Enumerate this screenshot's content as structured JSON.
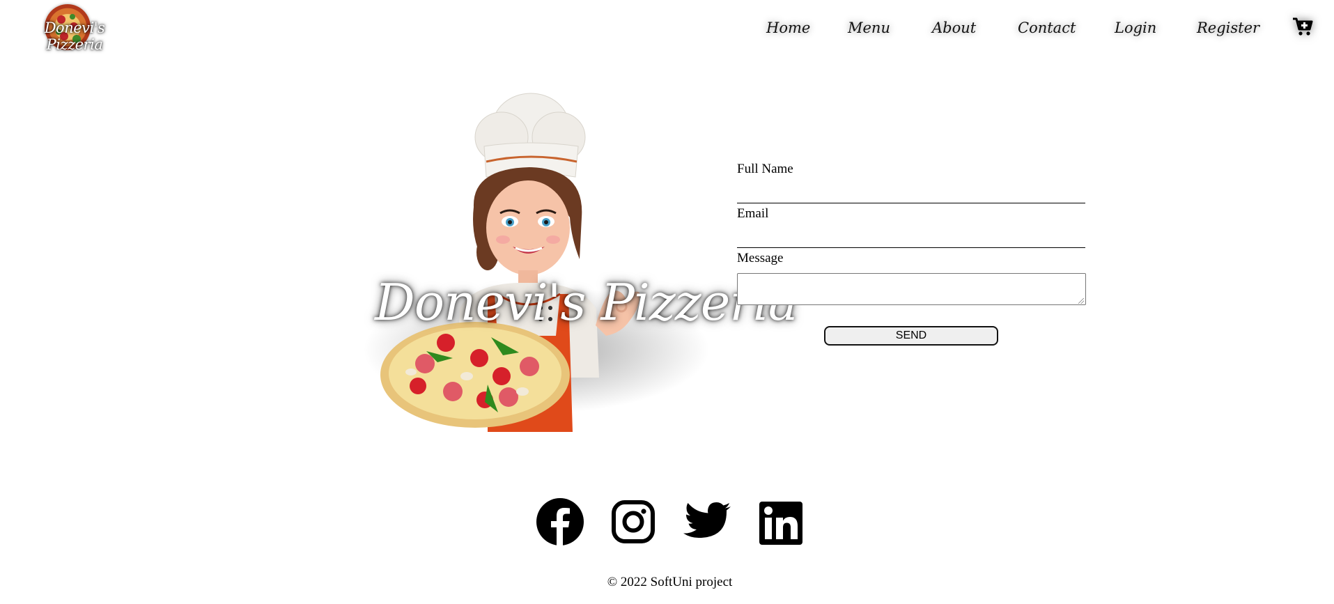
{
  "brand": {
    "logo_text": "Donevi's Pizzeria"
  },
  "nav": {
    "items": [
      {
        "label": "Home"
      },
      {
        "label": "Menu"
      },
      {
        "label": "About"
      },
      {
        "label": "Contact"
      },
      {
        "label": "Login"
      },
      {
        "label": "Register"
      }
    ],
    "cart_icon": "cart-plus-icon"
  },
  "hero": {
    "title": "Donevi's Pizzeria",
    "image": "chef-with-pizza-illustration"
  },
  "contact_form": {
    "full_name_label": "Full Name",
    "full_name_value": "",
    "email_label": "Email",
    "email_value": "",
    "message_label": "Message",
    "message_value": "",
    "submit_label": "SEND"
  },
  "footer": {
    "social_icons": [
      "facebook-icon",
      "instagram-icon",
      "twitter-icon",
      "linkedin-icon"
    ],
    "copyright": "© 2022 SoftUni project"
  },
  "colors": {
    "text": "#000000",
    "background": "#ffffff",
    "apron": "#e04a1a",
    "button_bg": "#efefef"
  }
}
